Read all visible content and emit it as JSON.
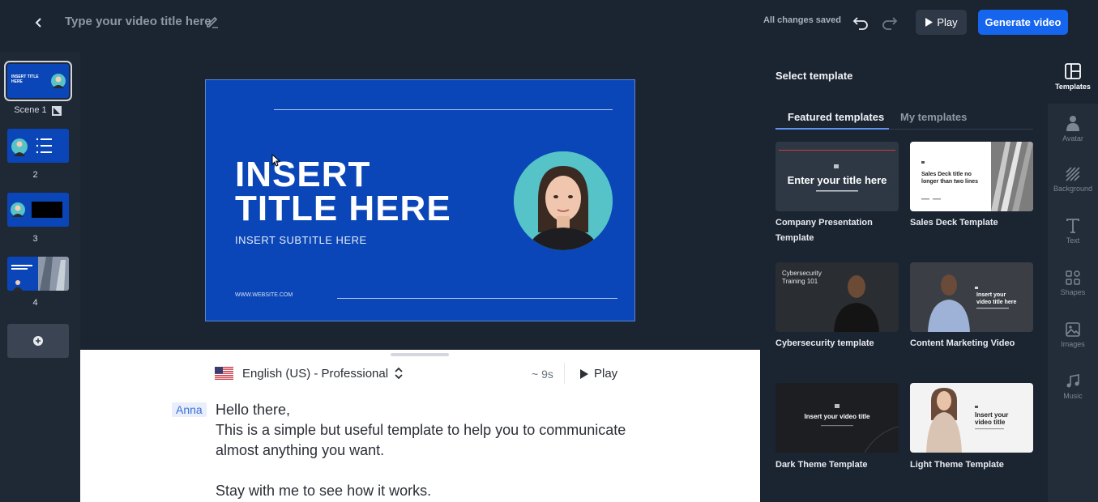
{
  "header": {
    "title": "Type your video title here",
    "saved_status": "All changes saved",
    "play_label": "Play",
    "generate_label": "Generate video"
  },
  "scenes": [
    {
      "label": "Scene 1",
      "thumb_text": "INSERT TITLE HERE"
    },
    {
      "label": "2"
    },
    {
      "label": "3"
    },
    {
      "label": "4"
    }
  ],
  "slide": {
    "title_line1": "INSERT",
    "title_line2": "TITLE HERE",
    "subtitle": "INSERT SUBTITLE HERE",
    "website": "WWW.WEBSITE.COM"
  },
  "script": {
    "voice": "English (US) - Professional",
    "duration": "~ 9s",
    "play_label": "Play",
    "speaker": "Anna",
    "lines": [
      "Hello there,",
      "This is a simple but useful template to help you to communicate almost anything you want.",
      "",
      "Stay with me to see how it works."
    ]
  },
  "templates_panel": {
    "title": "Select template",
    "tabs": [
      "Featured templates",
      "My templates"
    ],
    "active_tab": "Featured templates",
    "cards": [
      {
        "name": "Company Presentation Template",
        "thumb_text": "Enter your title here"
      },
      {
        "name": "Sales Deck Template",
        "thumb_text": "Sales Deck title no longer than two lines"
      },
      {
        "name": "Cybersecurity template",
        "thumb_text": "Cybersecurity Training 101"
      },
      {
        "name": "Content Marketing Video",
        "thumb_text": "Insert your video title here"
      },
      {
        "name": "Dark Theme Template",
        "thumb_text": "Insert your video title"
      },
      {
        "name": "Light Theme Template",
        "thumb_text": "Insert your video title"
      }
    ]
  },
  "rail": [
    {
      "label": "Templates",
      "icon": "templates-icon",
      "active": true
    },
    {
      "label": "Avatar",
      "icon": "avatar-icon"
    },
    {
      "label": "Background",
      "icon": "background-icon"
    },
    {
      "label": "Text",
      "icon": "text-icon"
    },
    {
      "label": "Shapes",
      "icon": "shapes-icon"
    },
    {
      "label": "Images",
      "icon": "images-icon"
    },
    {
      "label": "Music",
      "icon": "music-icon"
    }
  ],
  "colors": {
    "accent": "#1565ef",
    "slide_bg": "#0a46b8",
    "avatar_bg": "#55c3c7"
  }
}
